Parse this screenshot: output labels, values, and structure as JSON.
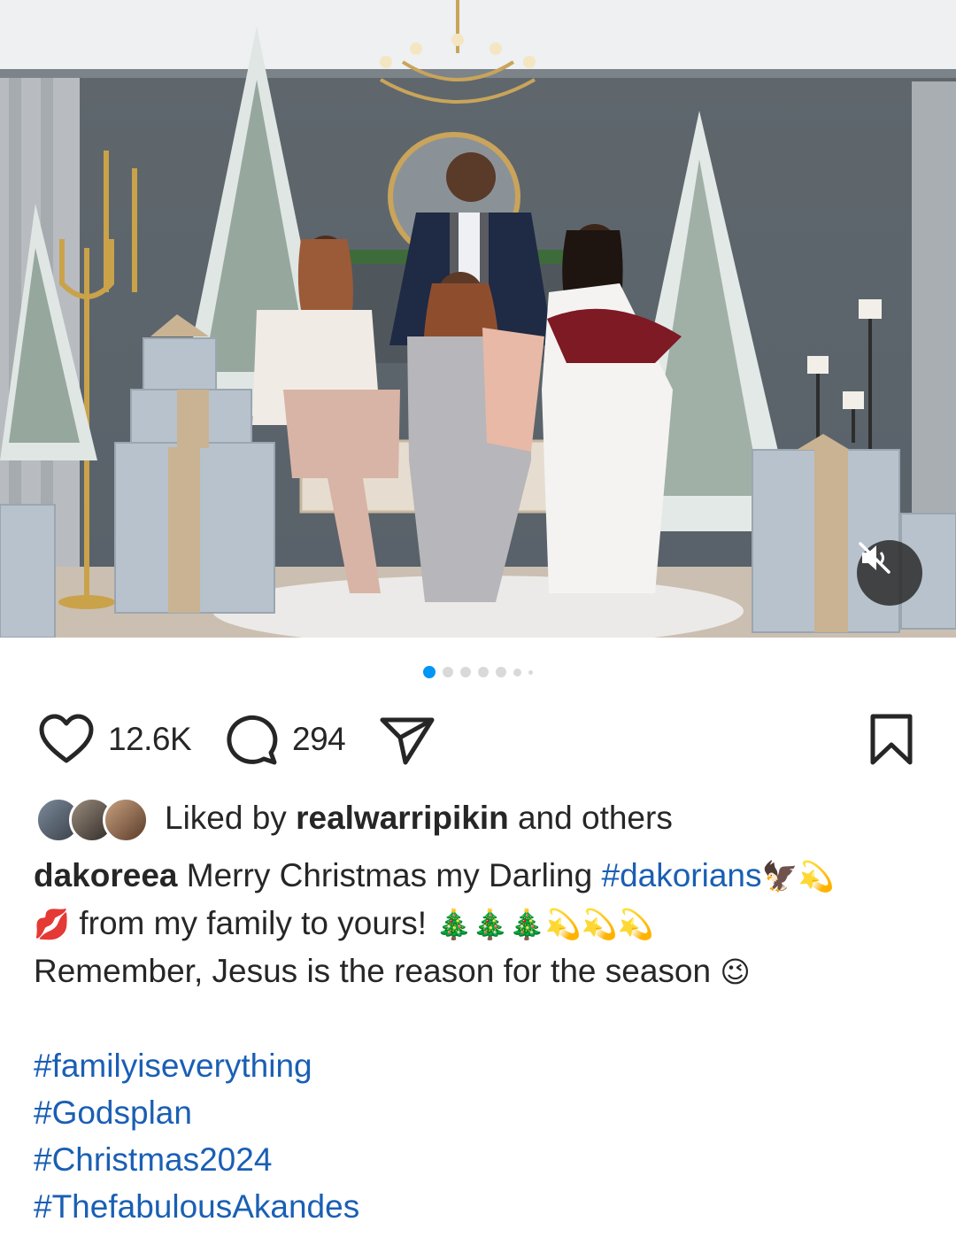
{
  "post": {
    "media": {
      "carousel_total": 7,
      "carousel_active": 0,
      "mute_icon": "speaker-muted-icon"
    },
    "actions": {
      "like_icon": "heart-icon",
      "like_count": "12.6K",
      "comment_icon": "comment-bubble-icon",
      "comment_count": "294",
      "share_icon": "paper-plane-icon",
      "save_icon": "bookmark-icon"
    },
    "liked_by": {
      "prefix": "Liked by",
      "user": "realwarripikin",
      "suffix": "and others"
    },
    "caption": {
      "username": "dakoreea",
      "line1_text": "Merry Christmas my Darling",
      "line1_tag": "#dakorians",
      "line1_emoji": "🦅💫",
      "line2_emoji_lead": "💋",
      "line2_text": "from my family to yours!",
      "line2_emoji_trail": "🎄🎄🎄💫💫💫",
      "line3_text": "Remember, Jesus is the reason for the season",
      "line3_emoji": "😉",
      "hashtags": [
        "#familyiseverything",
        "#Godsplan",
        "#Christmas2024",
        "#ThefabulousAkandes"
      ]
    },
    "colors": {
      "accent_dot": "#0095f6",
      "hashtag": "#1a5fb4",
      "text": "#262626"
    }
  }
}
